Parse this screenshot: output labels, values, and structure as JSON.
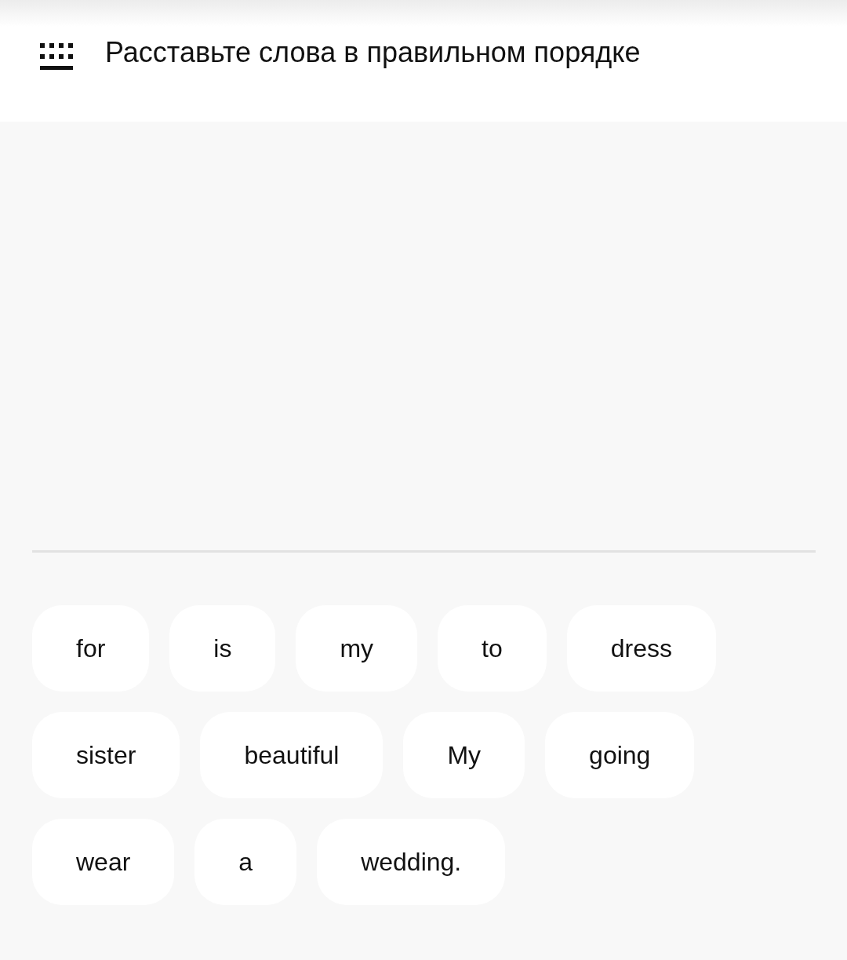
{
  "header": {
    "title": "Расставьте слова в правильном порядке"
  },
  "word_bank": [
    "for",
    "is",
    "my",
    "to",
    "dress",
    "sister",
    "beautiful",
    "My",
    "going",
    "wear",
    "a",
    "wedding."
  ]
}
